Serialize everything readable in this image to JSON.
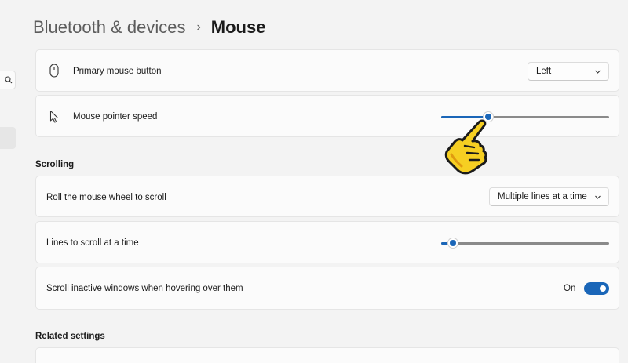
{
  "breadcrumb": {
    "parent": "Bluetooth & devices",
    "separator": "›",
    "current": "Mouse"
  },
  "settings": {
    "primary_button": {
      "label": "Primary mouse button",
      "icon": "mouse-icon",
      "value": "Left"
    },
    "pointer_speed": {
      "label": "Mouse pointer speed",
      "icon": "pointer-arrow-icon",
      "level_fraction": 0.28
    }
  },
  "scrolling": {
    "title": "Scrolling",
    "roll_wheel": {
      "label": "Roll the mouse wheel to scroll",
      "value": "Multiple lines at a time"
    },
    "lines": {
      "label": "Lines to scroll at a time",
      "level_fraction": 0.07
    },
    "inactive": {
      "label": "Scroll inactive windows when hovering over them",
      "state": "On"
    }
  },
  "related": {
    "title": "Related settings"
  },
  "colors": {
    "accent": "#1a66b8",
    "background": "#f3f3f3",
    "card": "#fbfbfb"
  }
}
